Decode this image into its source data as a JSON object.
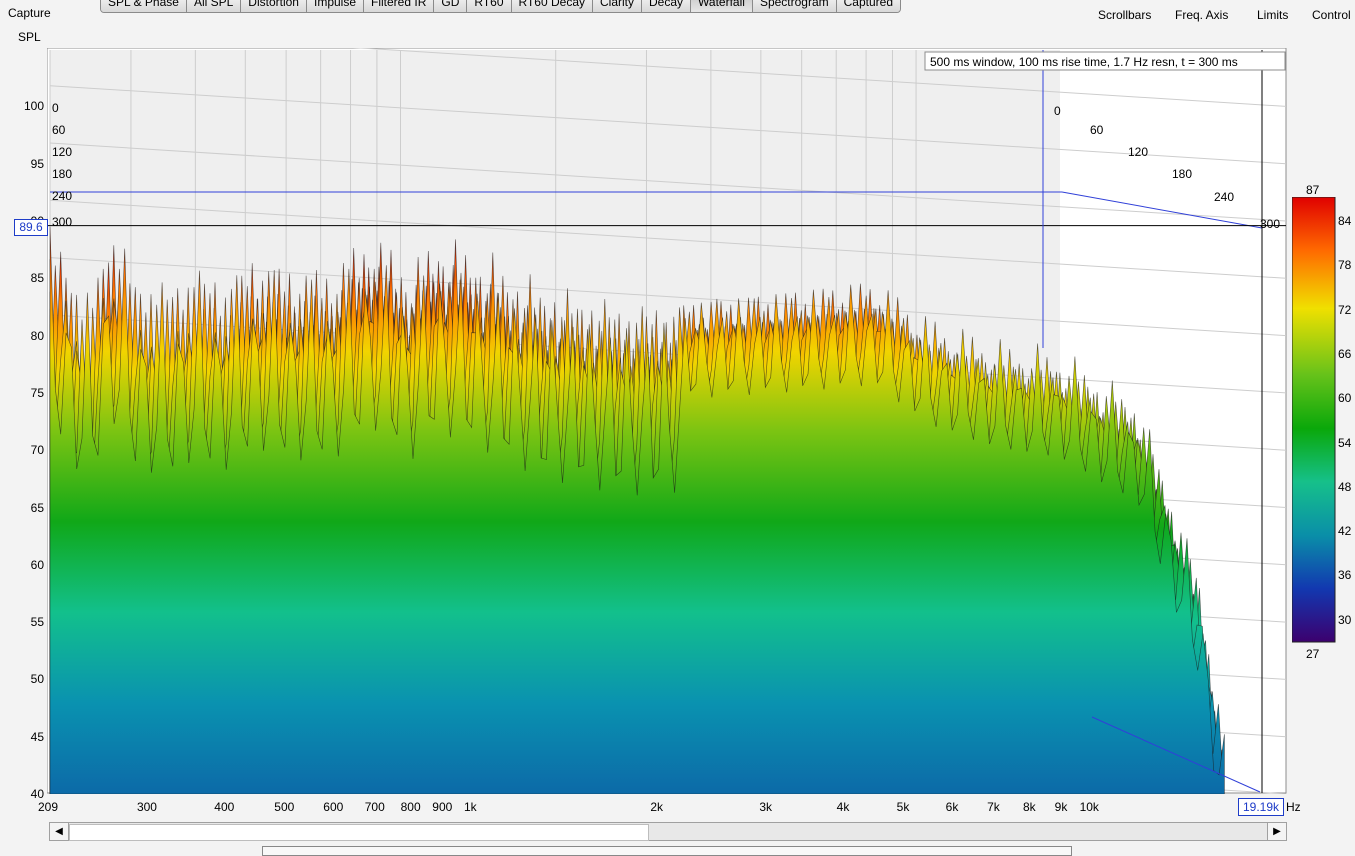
{
  "app": {
    "capture_label": "Capture"
  },
  "tabs": [
    {
      "label": "SPL & Phase",
      "active": false
    },
    {
      "label": "All SPL",
      "active": false
    },
    {
      "label": "Distortion",
      "active": false
    },
    {
      "label": "Impulse",
      "active": false
    },
    {
      "label": "Filtered IR",
      "active": false
    },
    {
      "label": "GD",
      "active": false
    },
    {
      "label": "RT60",
      "active": false
    },
    {
      "label": "RT60 Decay",
      "active": false
    },
    {
      "label": "Clarity",
      "active": false
    },
    {
      "label": "Decay",
      "active": false
    },
    {
      "label": "Waterfall",
      "active": true
    },
    {
      "label": "Spectrogram",
      "active": false
    },
    {
      "label": "Captured",
      "active": false
    }
  ],
  "top_links": {
    "scrollbars": "Scrollbars",
    "freq_axis": "Freq. Axis",
    "limits": "Limits",
    "controls": "Control"
  },
  "chart_data": {
    "type": "area",
    "subtype": "waterfall",
    "info_text": "500 ms window, 100 ms rise time,  1.7 Hz resn, t = 300 ms",
    "ylabel": "SPL",
    "xunit": "Hz",
    "ylim": [
      40,
      102
    ],
    "xlim": [
      209,
      19190
    ],
    "x_scale": "log",
    "y_ticks": [
      100,
      95,
      90,
      85,
      80,
      75,
      70,
      65,
      60,
      55,
      50,
      45,
      40
    ],
    "x_tick_labels": [
      "209",
      "300",
      "400",
      "500",
      "600",
      "700",
      "800",
      "900",
      "1k",
      "2k",
      "3k",
      "4k",
      "5k",
      "6k",
      "7k",
      "8k",
      "9k",
      "10k"
    ],
    "x_ticks": [
      209,
      300,
      400,
      500,
      600,
      700,
      800,
      900,
      1000,
      2000,
      3000,
      4000,
      5000,
      6000,
      7000,
      8000,
      9000,
      10000
    ],
    "time_labels_ms": [
      "0",
      "60",
      "120",
      "180",
      "240",
      "300"
    ],
    "cursor_y": "89.6",
    "cursor_x": "19.19k",
    "color_scale": {
      "max": "87",
      "min": "27",
      "ticks": [
        "84",
        "78",
        "72",
        "66",
        "60",
        "54",
        "48",
        "42",
        "36",
        "30"
      ]
    },
    "front_slice_peaks": [
      {
        "f": 215,
        "spl": 89.5
      },
      {
        "f": 240,
        "spl": 84
      },
      {
        "f": 262,
        "spl": 90.5
      },
      {
        "f": 290,
        "spl": 86
      },
      {
        "f": 320,
        "spl": 85.5
      },
      {
        "f": 360,
        "spl": 87
      },
      {
        "f": 400,
        "spl": 86
      },
      {
        "f": 450,
        "spl": 88
      },
      {
        "f": 520,
        "spl": 87
      },
      {
        "f": 600,
        "spl": 87
      },
      {
        "f": 690,
        "spl": 90
      },
      {
        "f": 800,
        "spl": 87
      },
      {
        "f": 880,
        "spl": 89.5
      },
      {
        "f": 1000,
        "spl": 88.5
      },
      {
        "f": 1300,
        "spl": 85.5
      },
      {
        "f": 1800,
        "spl": 84
      },
      {
        "f": 2500,
        "spl": 84.5
      },
      {
        "f": 3500,
        "spl": 85
      },
      {
        "f": 4500,
        "spl": 85.5
      },
      {
        "f": 5500,
        "spl": 82
      },
      {
        "f": 7000,
        "spl": 80
      },
      {
        "f": 9000,
        "spl": 79
      },
      {
        "f": 12000,
        "spl": 75
      },
      {
        "f": 15000,
        "spl": 60
      },
      {
        "f": 16500,
        "spl": 46
      }
    ],
    "colors": {
      "cursor": "#1e3cc8",
      "grid": "#c8c8c8",
      "floor": "#0f8fb0"
    }
  }
}
